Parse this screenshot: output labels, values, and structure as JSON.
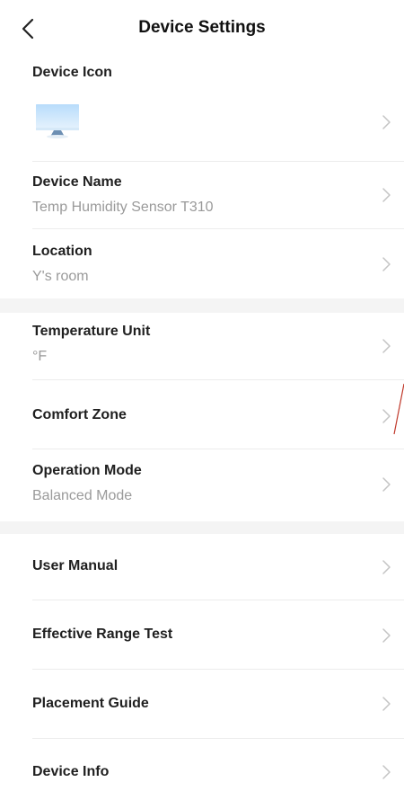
{
  "header": {
    "title": "Device Settings"
  },
  "icons": {
    "back": "chevron-left-icon",
    "row_arrow": "chevron-right-icon",
    "device": "desktop-monitor-icon"
  },
  "colors": {
    "gap": "#f4f4f4",
    "subtext": "#9a9a9a",
    "chevron": "#c4c4c4"
  },
  "section1": {
    "device_icon": {
      "label": "Device Icon"
    },
    "device_name": {
      "label": "Device Name",
      "value": "Temp Humidity Sensor T310"
    },
    "location": {
      "label": "Location",
      "value": "Y's room"
    }
  },
  "section2": {
    "temperature_unit": {
      "label": "Temperature Unit",
      "value": "°F"
    },
    "comfort_zone": {
      "label": "Comfort Zone"
    },
    "operation_mode": {
      "label": "Operation Mode",
      "value": "Balanced Mode"
    }
  },
  "section3": {
    "user_manual": {
      "label": "User Manual"
    },
    "effective_range_test": {
      "label": "Effective Range Test"
    },
    "placement_guide": {
      "label": "Placement Guide"
    },
    "device_info": {
      "label": "Device Info"
    }
  }
}
